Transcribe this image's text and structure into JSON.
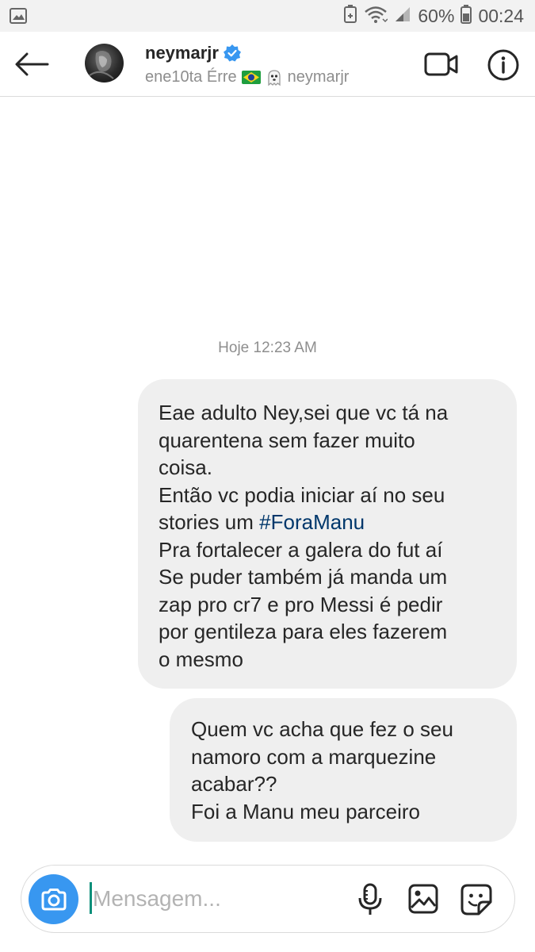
{
  "status_bar": {
    "battery_percent": "60%",
    "time": "00:24",
    "icons": [
      "gallery-notification-icon",
      "battery-saver-icon",
      "wifi-icon",
      "signal-icon",
      "battery-icon"
    ]
  },
  "header": {
    "username": "neymarjr",
    "verified": true,
    "subtitle_name": "ene10ta Érre",
    "subtitle_handle": "neymarjr",
    "icons": [
      "back-arrow-icon",
      "verified-badge-icon",
      "brazil-flag-icon",
      "ghost-icon",
      "video-call-icon",
      "info-icon"
    ]
  },
  "chat": {
    "timestamp": "Hoje 12:23 AM",
    "messages": [
      {
        "lines": [
          "Eae adulto Ney,sei que vc tá na",
          "quarentena sem fazer muito",
          "coisa.",
          "Então vc podia iniciar aí no seu",
          "stories um ",
          "Pra fortalecer a galera do fut aí",
          "Se puder também já manda um",
          "zap pro cr7 e pro Messi é pedir",
          "por gentileza para eles fazerem",
          "o mesmo"
        ],
        "hashtag": "#ForaManu"
      },
      {
        "lines": [
          "Quem vc acha que fez o seu",
          "namoro com a marquezine",
          "acabar??",
          "Foi a Manu meu parceiro"
        ]
      }
    ]
  },
  "composer": {
    "placeholder": "Mensagem...",
    "accent_color": "#3897f0",
    "icons": [
      "camera-icon",
      "microphone-icon",
      "gallery-icon",
      "sticker-icon"
    ]
  }
}
